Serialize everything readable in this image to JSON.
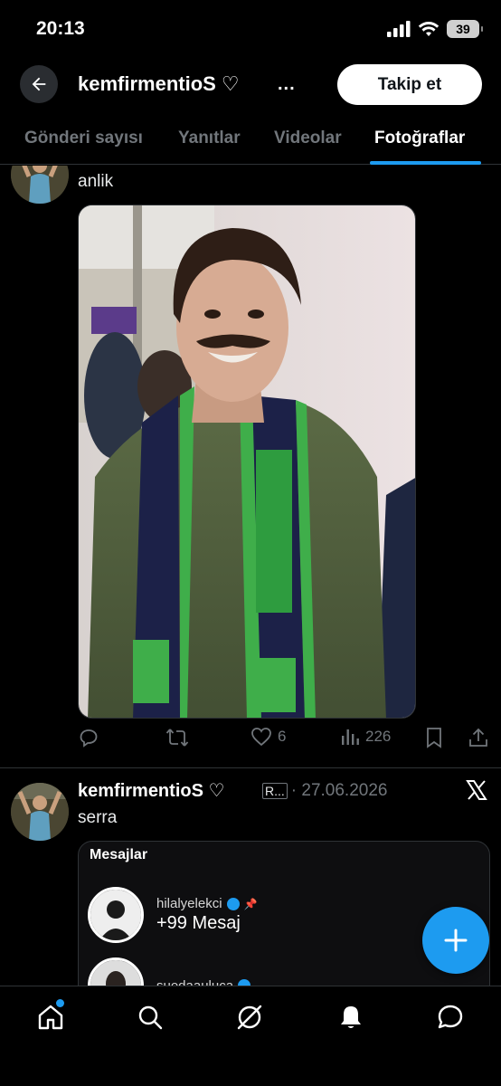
{
  "status_bar": {
    "time": "20:13",
    "battery": "39"
  },
  "header": {
    "title": "kemfirmentioS ♡",
    "more": "...",
    "follow_label": "Takip et"
  },
  "tabs": [
    {
      "label": "Gönderi sayısı",
      "active": false
    },
    {
      "label": "Yanıtlar",
      "active": false
    },
    {
      "label": "Videolar",
      "active": false
    },
    {
      "label": "Fotoğraflar",
      "active": true
    }
  ],
  "posts": [
    {
      "text": "anlik",
      "media": "photo of smiling young man with mustache wearing green jacket and green-white-navy scarf",
      "actions": {
        "reply": "",
        "repost": "",
        "like": "6",
        "views": "226"
      }
    },
    {
      "author": "kemfirmentioS ♡",
      "handle_abbrev": "R...",
      "date": "· 27.06.2026",
      "text": "serra",
      "embedded": {
        "title": "Mesajlar",
        "rows": [
          {
            "name": "hilalyelekci",
            "count": "+99 Mesaj"
          },
          {
            "name": "suedaauluca",
            "count": ""
          }
        ]
      }
    }
  ],
  "colors": {
    "accent": "#1d9bf0",
    "background": "#000000",
    "muted": "#71767b"
  }
}
